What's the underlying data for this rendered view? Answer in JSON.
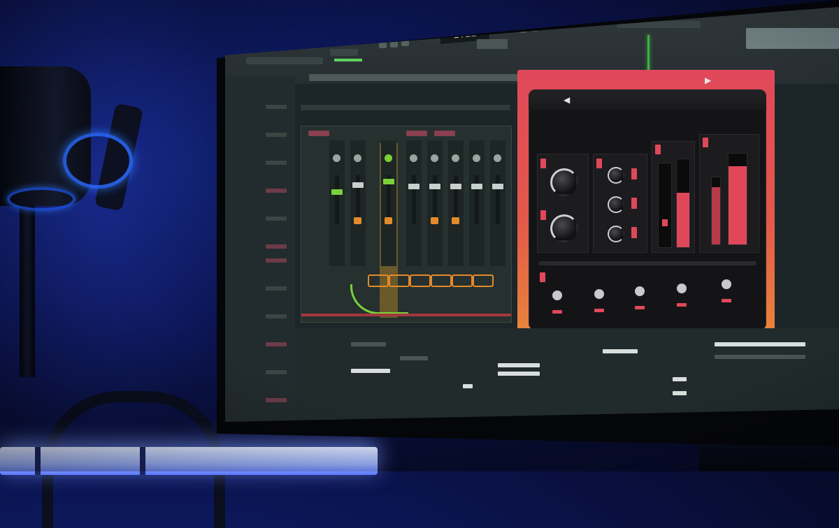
{
  "scene": {
    "description_text": "",
    "colors": {
      "ambient_blue": "#1a2a9a",
      "plugin_accent": "#e0485a",
      "plugin_frame_orange": "#e8873a",
      "daw_green": "#3fb040",
      "mixer_orange": "#e48a2a"
    }
  },
  "daw": {
    "time_display": "1:22",
    "plugin": {
      "title": "",
      "prev_icon": "◀",
      "next_icon": "▶",
      "meter_levels": [
        0.62,
        0.55,
        0.85
      ]
    }
  },
  "icons": [
    "microphone-icon",
    "headphones-icon",
    "knob-icon"
  ]
}
